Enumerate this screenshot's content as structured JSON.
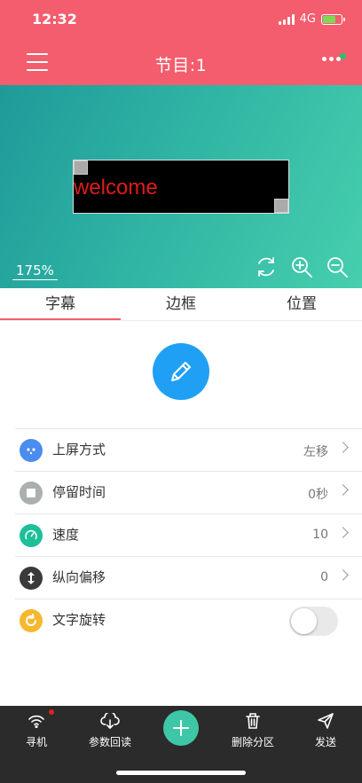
{
  "status_bar": {
    "time": "12:32",
    "network": "4G"
  },
  "header": {
    "title": "节目:1",
    "menu_icon": "hamburger-menu-icon",
    "more_icon": "more-dots-icon",
    "accent": "#f45d6d"
  },
  "preview": {
    "led_text": "welcome",
    "zoom": "175%",
    "led_text_color": "#e01b1b"
  },
  "tabs": [
    {
      "label": "字幕",
      "active": true
    },
    {
      "label": "边框",
      "active": false
    },
    {
      "label": "位置",
      "active": false
    }
  ],
  "edit_button": {
    "icon": "pencil-icon",
    "color": "#1fa0f5"
  },
  "settings": {
    "rows": [
      {
        "label": "上屏方式",
        "value": "左移",
        "icon": "entry-mode-icon",
        "color": "#4a8cf0"
      },
      {
        "label": "停留时间",
        "value": "0秒",
        "icon": "stay-time-icon",
        "color": "#aab0ae"
      },
      {
        "label": "速度",
        "value": "10",
        "icon": "speed-icon",
        "color": "#1dbf9a"
      },
      {
        "label": "纵向偏移",
        "value": "0",
        "icon": "vertical-offset-icon",
        "color": "#3a3a3a"
      },
      {
        "label": "文字旋转",
        "value": "",
        "icon": "rotate-text-icon",
        "color": "#f5b82e",
        "toggle": false
      }
    ]
  },
  "bottom_nav": {
    "items": [
      {
        "label": "寻机",
        "icon": "wifi-icon"
      },
      {
        "label": "参数回读",
        "icon": "cloud-download-icon"
      },
      {
        "label": "删除分区",
        "icon": "trash-icon"
      },
      {
        "label": "发送",
        "icon": "send-icon"
      }
    ],
    "add_icon": "plus-icon"
  }
}
